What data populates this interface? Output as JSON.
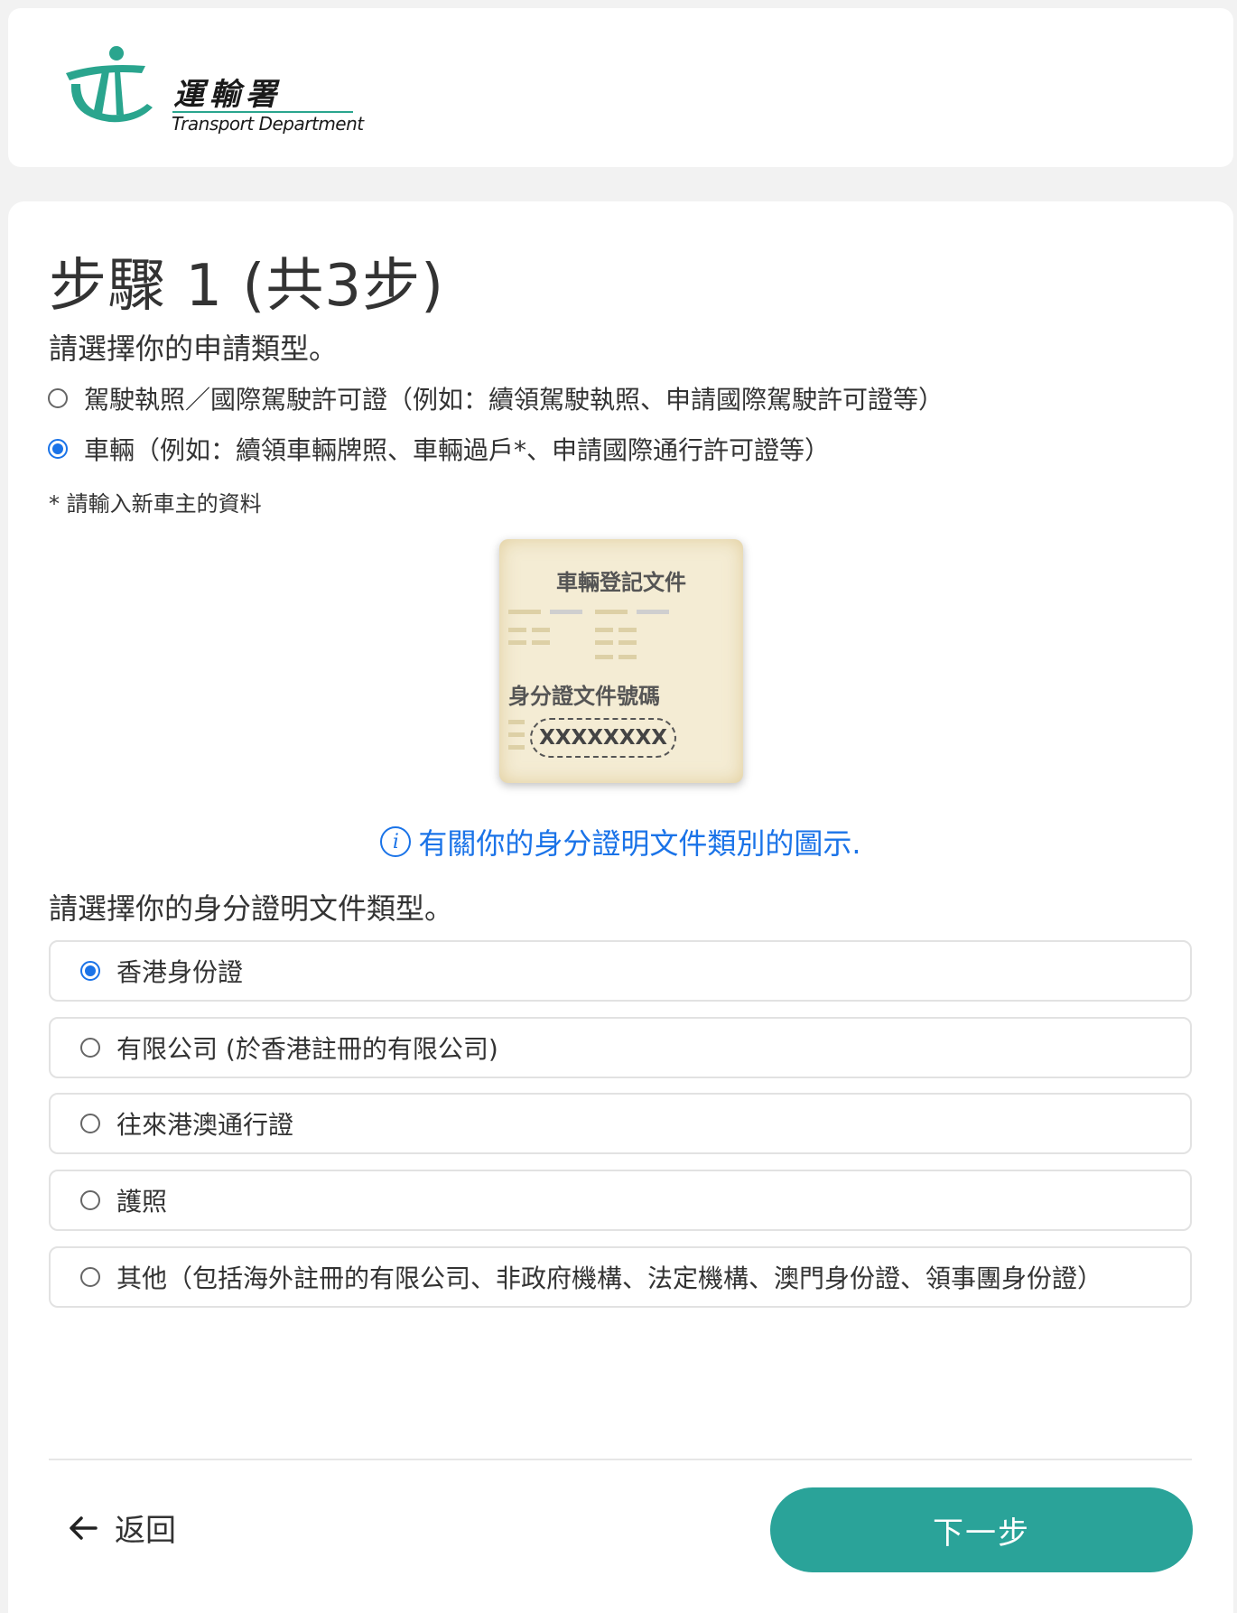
{
  "header": {
    "logo_zh": "運輸署",
    "logo_en": "Transport Department"
  },
  "step": {
    "title": "步驟 1 (共3步)"
  },
  "application_type": {
    "question": "請選擇你的申請類型。",
    "options": [
      {
        "label": "駕駛執照／國際駕駛許可證（例如：續領駕駛執照、申請國際駕駛許可證等）",
        "checked": false
      },
      {
        "label": "車輛（例如：續領車輛牌照、車輛過戶*、申請國際通行許可證等）",
        "checked": true
      }
    ],
    "note": "* 請輸入新車主的資料"
  },
  "illustration": {
    "doc_title": "車輛登記文件",
    "id_label": "身分證文件號碼",
    "id_value": "XXXXXXXX"
  },
  "info_link": {
    "text": "有關你的身分證明文件類別的圖示."
  },
  "id_type": {
    "question": "請選擇你的身分證明文件類型。",
    "options": [
      {
        "label": "香港身份證",
        "checked": true
      },
      {
        "label": "有限公司 (於香港註冊的有限公司)",
        "checked": false
      },
      {
        "label": "往來港澳通行證",
        "checked": false
      },
      {
        "label": "護照",
        "checked": false
      },
      {
        "label": "其他（包括海外註冊的有限公司、非政府機構、法定機構、澳門身份證、領事團身份證）",
        "checked": false
      }
    ]
  },
  "footer": {
    "back_label": "返回",
    "next_label": "下一步"
  },
  "colors": {
    "brand_teal": "#2aa399",
    "link_blue": "#1a73e8"
  }
}
